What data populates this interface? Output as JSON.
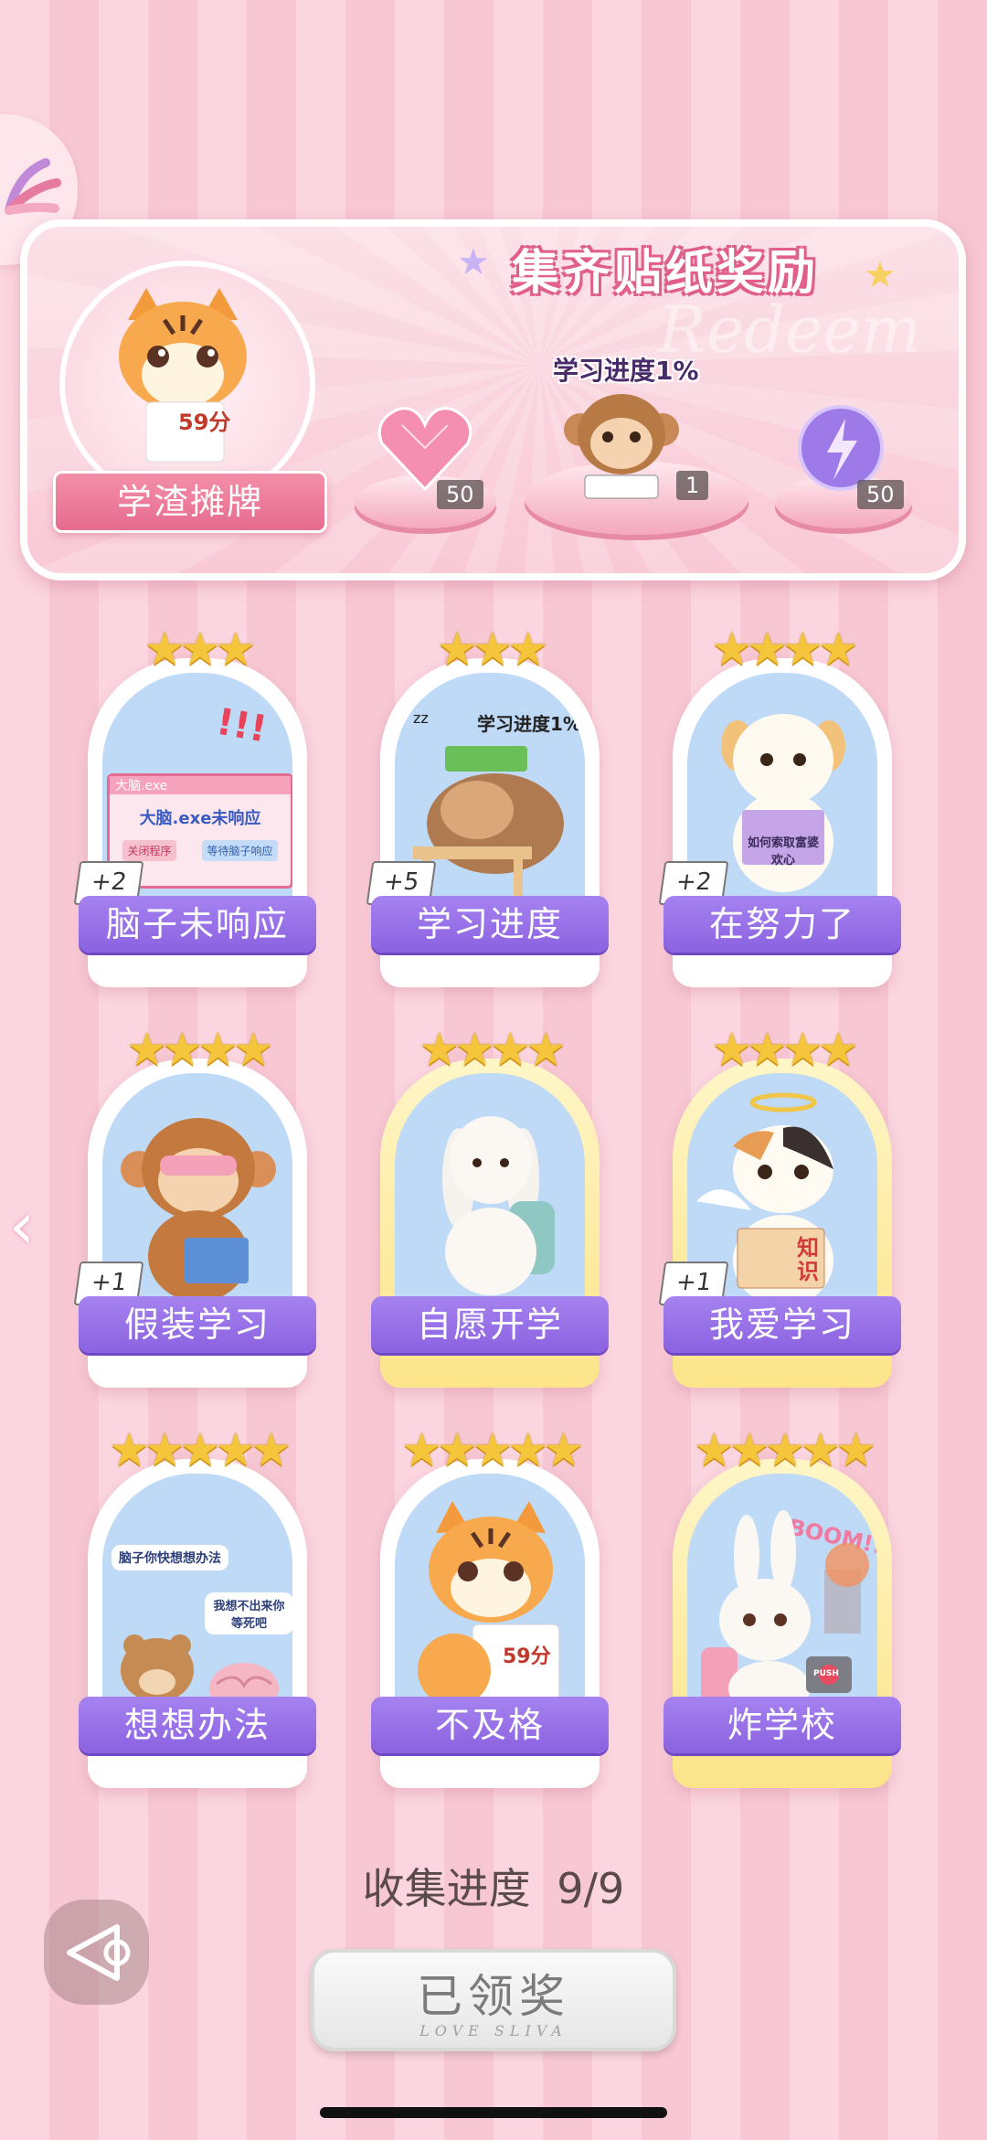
{
  "reward_panel": {
    "title": "集齐贴纸奖励",
    "watermark": "Redeem",
    "badge_label": "学渣摊牌",
    "tiger_paper_text": "59分",
    "progress_caption": "学习进度1%",
    "rewards": [
      {
        "icon": "pink-heart-gem-icon",
        "count": "50"
      },
      {
        "icon": "monkey-sticker-icon",
        "count": "1"
      },
      {
        "icon": "purple-lightning-orb-icon",
        "count": "50"
      }
    ]
  },
  "cards": [
    {
      "label": "脑子未响应",
      "stars": "★★★",
      "bonus": "+2",
      "gold": false,
      "art": {
        "window_title": "大脑.exe",
        "message": "大脑.exe未响应",
        "btn_close": "关闭程序",
        "btn_wait": "等待脑子响应"
      }
    },
    {
      "label": "学习进度",
      "stars": "★★★",
      "bonus": "+5",
      "gold": false,
      "art": {
        "caption": "学习进度1%",
        "zz": "zz"
      }
    },
    {
      "label": "在努力了",
      "stars": "★★★★",
      "bonus": "+2",
      "gold": false,
      "art": {
        "book_text": "如何索取富婆欢心"
      }
    },
    {
      "label": "假装学习",
      "stars": "★★★★",
      "bonus": "+1",
      "gold": false,
      "art": {}
    },
    {
      "label": "自愿开学",
      "stars": "★★★★",
      "bonus": "",
      "gold": true,
      "art": {}
    },
    {
      "label": "我爱学习",
      "stars": "★★★★",
      "bonus": "+1",
      "gold": true,
      "art": {
        "book_text": "知识"
      }
    },
    {
      "label": "想想办法",
      "stars": "★★★★★",
      "bonus": "",
      "gold": false,
      "art": {
        "bubble1": "脑子你快想想办法",
        "bubble2": "我想不出来你等死吧"
      }
    },
    {
      "label": "不及格",
      "stars": "★★★★★",
      "bonus": "",
      "gold": false,
      "art": {
        "paper": "59分"
      }
    },
    {
      "label": "炸学校",
      "stars": "★★★★★",
      "bonus": "",
      "gold": true,
      "art": {
        "boom": "BOOM!!",
        "push": "PUSH"
      }
    }
  ],
  "footer": {
    "progress_label": "收集进度",
    "progress_value": "9/9",
    "claim_button": "已领奖",
    "claim_sub": "LOVE SLIVA"
  },
  "colors": {
    "label_purple": "#8b62e0",
    "panel_pink": "#f9c9d6",
    "star_gold": "#f5c63c"
  }
}
